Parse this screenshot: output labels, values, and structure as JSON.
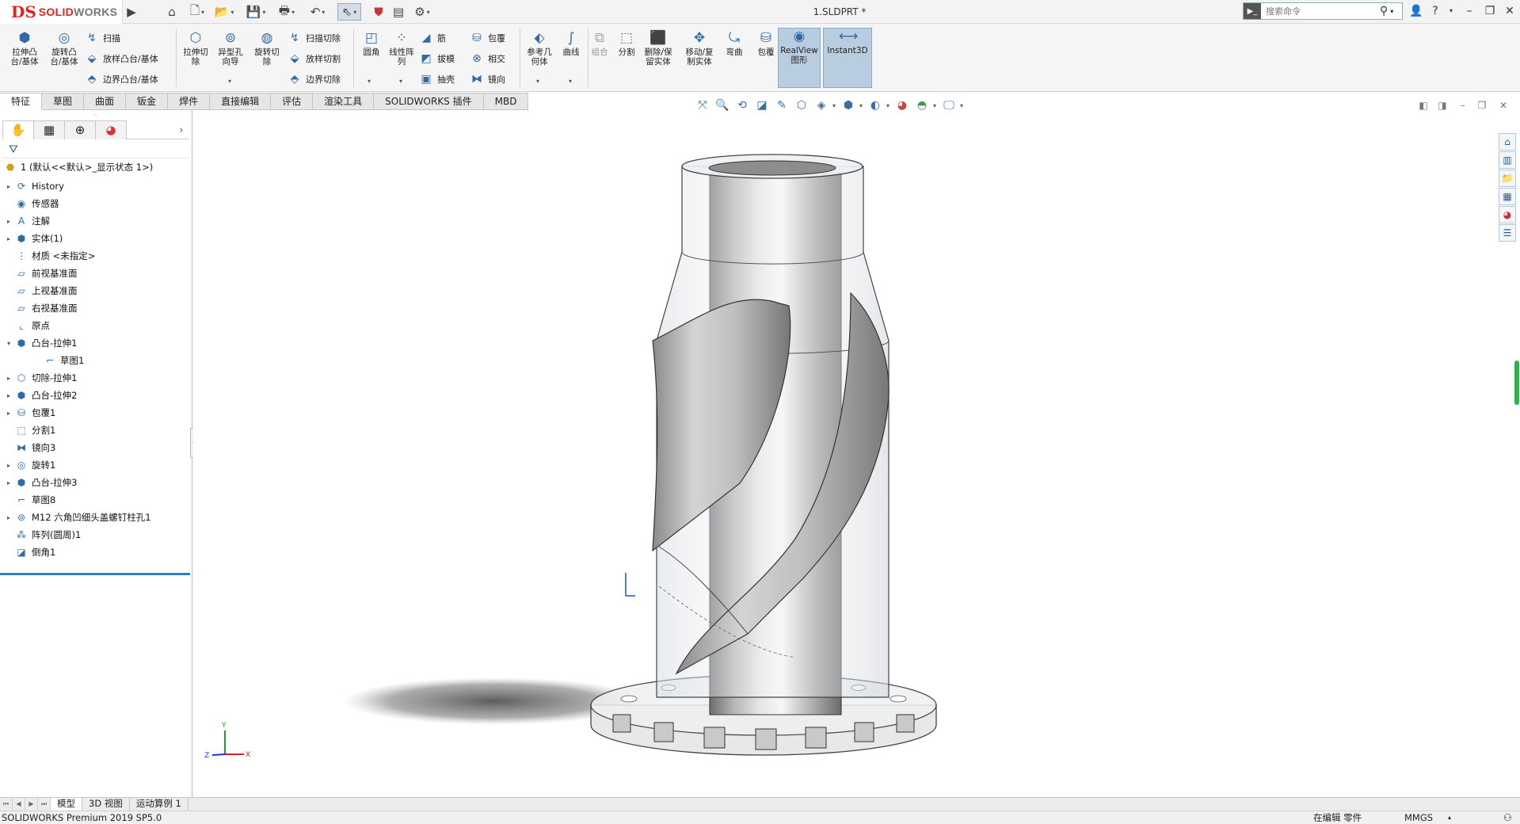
{
  "app": {
    "logo_mark": "DS",
    "logo_text_a": "SOLID",
    "logo_text_b": "WORKS",
    "document_title": "1.SLDPRT *"
  },
  "search": {
    "placeholder": "搜索命令"
  },
  "ribbon": {
    "features": {
      "extrude_boss": "拉伸凸\n台/基体",
      "revolve_boss": "旋转凸\n台/基体",
      "sweep": "扫描",
      "loft_boss": "放样凸台/基体",
      "boundary_boss": "边界凸台/基体",
      "extrude_cut": "拉伸切\n除",
      "hole_wizard": "异型孔\n向导",
      "revolve_cut": "旋转切\n除",
      "swept_cut": "扫描切除",
      "lofted_cut": "放样切割",
      "boundary_cut": "边界切除",
      "fillet": "圆角",
      "linear_pattern": "线性阵\n列",
      "rib": "筋",
      "draft": "拔模",
      "shell": "抽壳",
      "wrap": "包覆",
      "intersect": "相交",
      "mirror": "镜向",
      "reference_geometry": "参考几\n何体",
      "curves": "曲线",
      "combine": "组合",
      "split": "分割",
      "delete_keep_body": "删除/保\n留实体",
      "move_copy_body": "移动/复\n制实体",
      "flex": "弯曲",
      "wrap2": "包覆",
      "realview": "RealView\n图形",
      "instant3d": "Instant3D"
    }
  },
  "tabs": [
    "特征",
    "草图",
    "曲面",
    "钣金",
    "焊件",
    "直接编辑",
    "评估",
    "渲染工具",
    "SOLIDWORKS 插件",
    "MBD"
  ],
  "feature_tree": {
    "root": "1  (默认<<默认>_显示状态 1>)",
    "items": [
      {
        "label": "History",
        "icon": "history-icon",
        "expand": "▸"
      },
      {
        "label": "传感器",
        "icon": "sensor-icon",
        "expand": ""
      },
      {
        "label": "注解",
        "icon": "annotation-icon",
        "expand": "▸"
      },
      {
        "label": "实体(1)",
        "icon": "solid-bodies-icon",
        "expand": "▸"
      },
      {
        "label": "材质 <未指定>",
        "icon": "material-icon",
        "expand": ""
      },
      {
        "label": "前视基准面",
        "icon": "plane-icon",
        "expand": ""
      },
      {
        "label": "上视基准面",
        "icon": "plane-icon",
        "expand": ""
      },
      {
        "label": "右视基准面",
        "icon": "plane-icon",
        "expand": ""
      },
      {
        "label": "原点",
        "icon": "origin-icon",
        "expand": ""
      },
      {
        "label": "凸台-拉伸1",
        "icon": "extrude-icon",
        "expand": "▾"
      },
      {
        "label": "草图1",
        "icon": "sketch-icon",
        "expand": ""
      },
      {
        "label": "切除-拉伸1",
        "icon": "cut-extrude-icon",
        "expand": "▸"
      },
      {
        "label": "凸台-拉伸2",
        "icon": "extrude-icon",
        "expand": "▸"
      },
      {
        "label": "包覆1",
        "icon": "wrap-icon",
        "expand": "▸"
      },
      {
        "label": "分割1",
        "icon": "split-icon",
        "expand": ""
      },
      {
        "label": "镜向3",
        "icon": "mirror-icon",
        "expand": ""
      },
      {
        "label": "旋转1",
        "icon": "revolve-icon",
        "expand": "▸"
      },
      {
        "label": "凸台-拉伸3",
        "icon": "extrude-icon",
        "expand": "▸"
      },
      {
        "label": "草图8",
        "icon": "sketch-icon",
        "expand": ""
      },
      {
        "label": "M12 六角凹细头盖螺钉柱孔1",
        "icon": "hole-icon",
        "expand": "▸"
      },
      {
        "label": "阵列(圆周)1",
        "icon": "circular-pattern-icon",
        "expand": ""
      },
      {
        "label": "倒角1",
        "icon": "chamfer-icon",
        "expand": ""
      }
    ]
  },
  "triad": {
    "x": "X",
    "y": "Y",
    "z": "Z"
  },
  "bottom_tabs": [
    "模型",
    "3D 视图",
    "运动算例 1"
  ],
  "status": {
    "product": "SOLIDWORKS Premium 2019 SP5.0",
    "mode": "在编辑 零件",
    "units": "MMGS"
  },
  "colors": {
    "accent": "#2d7fc1",
    "brand": "#e2231a",
    "active_tool": "#b9cde0"
  }
}
